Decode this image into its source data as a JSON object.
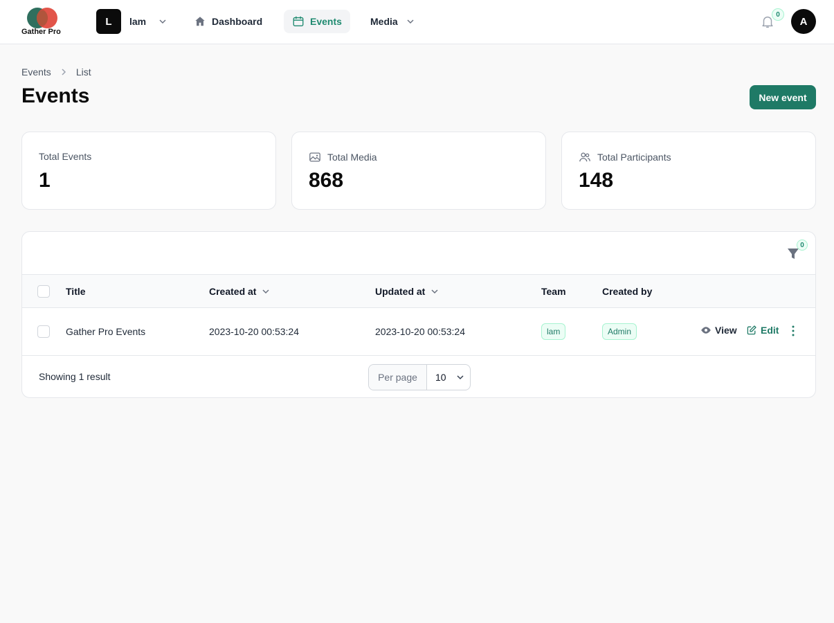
{
  "app": {
    "logo_text": "Gather Pro"
  },
  "tenant": {
    "initial": "L",
    "name": "lam"
  },
  "nav": {
    "dashboard": "Dashboard",
    "events": "Events",
    "media": "Media"
  },
  "notifications": {
    "count": "0"
  },
  "user": {
    "initial": "A"
  },
  "breadcrumb": {
    "root": "Events",
    "current": "List"
  },
  "page": {
    "title": "Events",
    "new_button": "New event"
  },
  "stats": [
    {
      "label": "Total Events",
      "value": "1"
    },
    {
      "label": "Total Media",
      "value": "868"
    },
    {
      "label": "Total Participants",
      "value": "148"
    }
  ],
  "table": {
    "filter_count": "0",
    "columns": {
      "title": "Title",
      "created_at": "Created at",
      "updated_at": "Updated at",
      "team": "Team",
      "created_by": "Created by"
    },
    "rows": [
      {
        "title": "Gather Pro Events",
        "created_at": "2023-10-20 00:53:24",
        "updated_at": "2023-10-20 00:53:24",
        "team": "lam",
        "created_by": "Admin",
        "view_label": "View",
        "edit_label": "Edit"
      }
    ],
    "footer": {
      "showing": "Showing 1 result",
      "per_page_label": "Per page",
      "per_page_value": "10"
    }
  },
  "colors": {
    "accent": "#1f7a66",
    "accent_light": "#ecfdf5"
  }
}
